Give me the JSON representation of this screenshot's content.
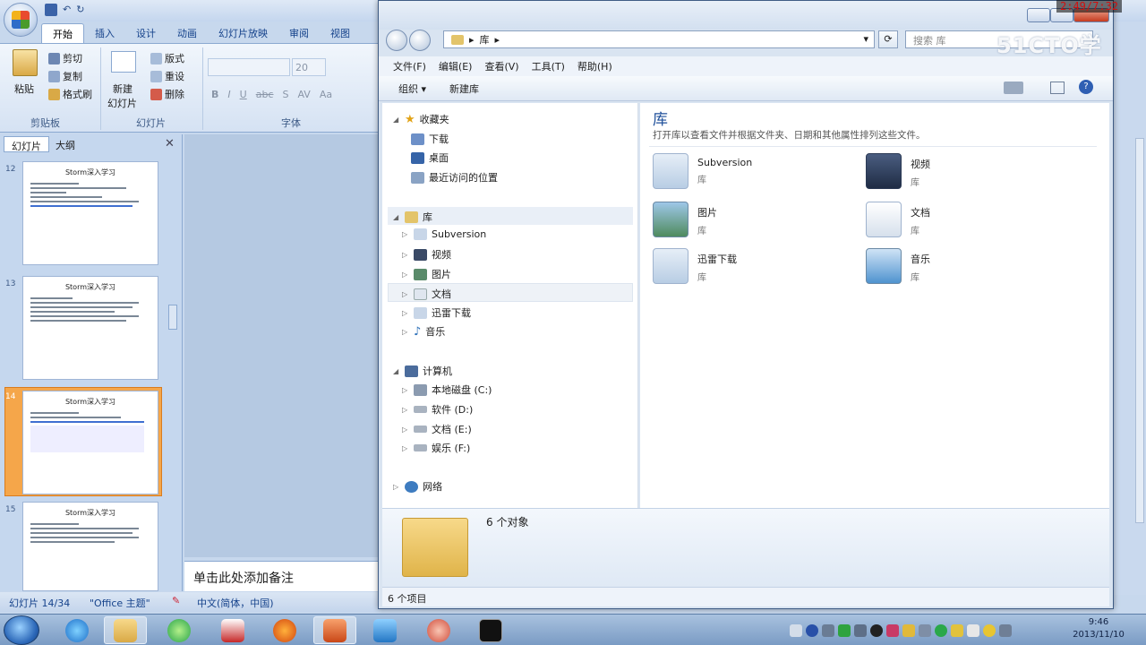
{
  "timer": "2:49/7:32",
  "powerpoint": {
    "tabs": [
      "开始",
      "插入",
      "设计",
      "动画",
      "幻灯片放映",
      "审阅",
      "视图"
    ],
    "clipboard": {
      "paste": "粘贴",
      "cut": "剪切",
      "copy": "复制",
      "format_painter": "格式刷",
      "group": "剪贴板"
    },
    "slides_group": {
      "new_slide": "新建\n幻灯片",
      "new_slide_l1": "新建",
      "new_slide_l2": "幻灯片",
      "layout": "版式",
      "reset": "重设",
      "delete": "删除",
      "group": "幻灯片"
    },
    "font_group": {
      "size": "20",
      "group": "字体"
    },
    "panel_tabs": {
      "slides": "幻灯片",
      "outline": "大纲"
    },
    "thumbnails": [
      {
        "num": "12",
        "title": "Storm深入学习"
      },
      {
        "num": "13",
        "title": "Storm深入学习"
      },
      {
        "num": "14",
        "title": "Storm深入学习"
      },
      {
        "num": "15",
        "title": "Storm深入学习"
      }
    ],
    "notes_placeholder": "单击此处添加备注",
    "status": {
      "slide": "幻灯片 14/34",
      "theme": "\"Office 主题\"",
      "language": "中文(简体，中国)"
    }
  },
  "explorer": {
    "address": "库",
    "search_placeholder": "搜索 库",
    "watermark": "51CTO学院",
    "menu": [
      "文件(F)",
      "编辑(E)",
      "查看(V)",
      "工具(T)",
      "帮助(H)"
    ],
    "toolbar": {
      "organize": "组织 ▾",
      "new_library": "新建库"
    },
    "nav": {
      "favorites": "收藏夹",
      "fav_items": [
        "下载",
        "桌面",
        "最近访问的位置"
      ],
      "libraries": "库",
      "lib_items": [
        "Subversion",
        "视频",
        "图片",
        "文档",
        "迅雷下载",
        "音乐"
      ],
      "computer": "计算机",
      "drives": [
        "本地磁盘 (C:)",
        "软件 (D:)",
        "文档 (E:)",
        "娱乐 (F:)"
      ],
      "network": "网络"
    },
    "content": {
      "heading": "库",
      "description": "打开库以查看文件并根据文件夹、日期和其他属性排列这些文件。",
      "libraries": [
        {
          "name": "Subversion",
          "type": "库"
        },
        {
          "name": "视频",
          "type": "库"
        },
        {
          "name": "图片",
          "type": "库"
        },
        {
          "name": "文档",
          "type": "库"
        },
        {
          "name": "迅雷下载",
          "type": "库"
        },
        {
          "name": "音乐",
          "type": "库"
        }
      ]
    },
    "details": "6 个对象",
    "status": "6 个项目"
  },
  "taskbar": {
    "time": "9:46",
    "date": "2013/11/10"
  }
}
